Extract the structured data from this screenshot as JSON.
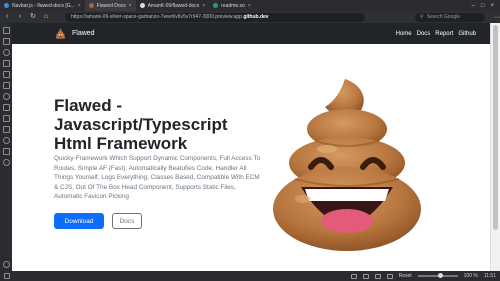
{
  "browser": {
    "tabs": [
      {
        "label": "Navbar.js - flawed-docs [G...",
        "color": "#3c8dde"
      },
      {
        "label": "Flawed Docs",
        "color": "#a46a35"
      },
      {
        "label": "AmanK-09/flawed-docs",
        "color": "#dddddd"
      },
      {
        "label": "readme.so",
        "color": "#2f9b6a"
      }
    ],
    "url_prefix": "https://amank-09-silver-space-garbanzo-7wwr6v6v5v7r947-3000.preview.app.",
    "url_domain": "github.dev",
    "search_placeholder": "Search Google",
    "zoom_value": 100,
    "zoom_label": "100 %",
    "reset_label": "Reset",
    "clock": "11:51"
  },
  "site": {
    "brand": "Flawed",
    "nav": [
      "Home",
      "Docs",
      "Report",
      "Github"
    ],
    "title": "Flawed - Javascript/Typescript Html Framework",
    "lead": "Quicky-Framework Which Support Dynamic Components, Full Access To Routes, Simple AF (Fast), Automatically Beatufies Code, Handler All Things Yourself, Logs Everything, Classes Based, Compatible With ECM & CJS, Out Of The Box Head Component, Supports Static Files, Automatic Favicon Picking",
    "primary_button": "Download",
    "secondary_button": "Docs"
  },
  "colors": {
    "navbar": "#212529",
    "primary": "#0d6efd",
    "secondary": "#6c757d",
    "poop_body": "#b8763f",
    "poop_shadow": "#8a4f22"
  },
  "icons": {
    "brand_logo": "poop-emoji-icon",
    "hero_image": "poop-emoji-icon"
  }
}
